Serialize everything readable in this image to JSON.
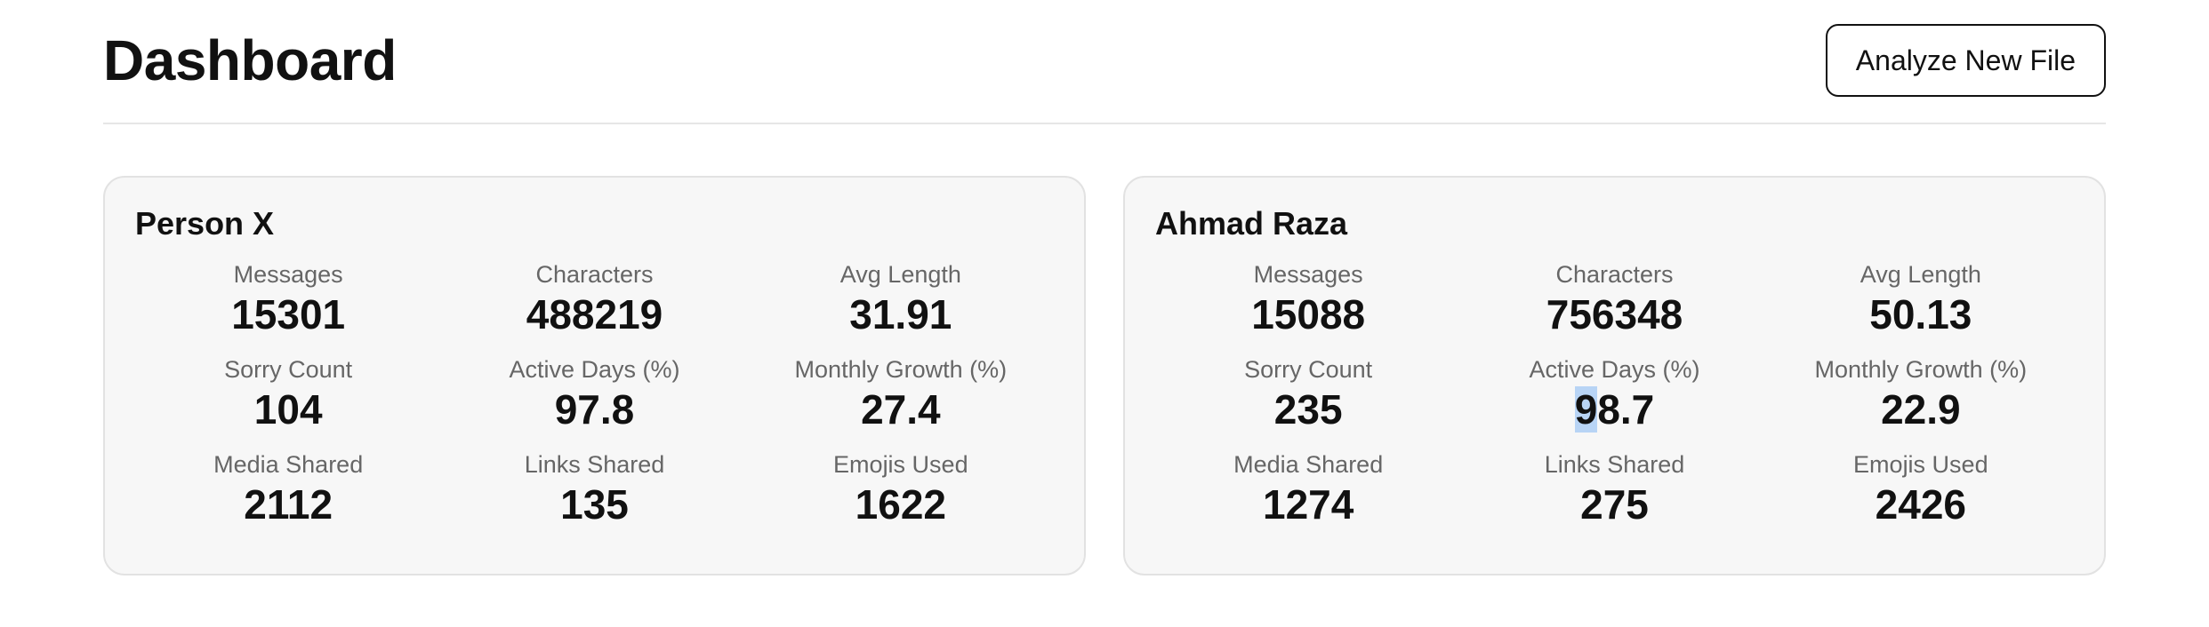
{
  "header": {
    "title": "Dashboard",
    "analyze_label": "Analyze New File"
  },
  "cards": [
    {
      "name": "Person X",
      "stats": [
        {
          "label": "Messages",
          "value": "15301"
        },
        {
          "label": "Characters",
          "value": "488219"
        },
        {
          "label": "Avg Length",
          "value": "31.91"
        },
        {
          "label": "Sorry Count",
          "value": "104"
        },
        {
          "label": "Active Days (%)",
          "value": "97.8"
        },
        {
          "label": "Monthly Growth (%)",
          "value": "27.4"
        },
        {
          "label": "Media Shared",
          "value": "2112"
        },
        {
          "label": "Links Shared",
          "value": "135"
        },
        {
          "label": "Emojis Used",
          "value": "1622"
        }
      ]
    },
    {
      "name": "Ahmad Raza",
      "stats": [
        {
          "label": "Messages",
          "value": "15088"
        },
        {
          "label": "Characters",
          "value": "756348"
        },
        {
          "label": "Avg Length",
          "value": "50.13"
        },
        {
          "label": "Sorry Count",
          "value": "235"
        },
        {
          "label": "Active Days (%)",
          "value": "98.7",
          "selected_part": "9",
          "rest_part": "8.7"
        },
        {
          "label": "Monthly Growth (%)",
          "value": "22.9"
        },
        {
          "label": "Media Shared",
          "value": "1274"
        },
        {
          "label": "Links Shared",
          "value": "275"
        },
        {
          "label": "Emojis Used",
          "value": "2426"
        }
      ]
    }
  ],
  "colors": {
    "selection_highlight": "#b8d4f5",
    "card_background": "#f7f7f7",
    "label_text": "#666666"
  }
}
